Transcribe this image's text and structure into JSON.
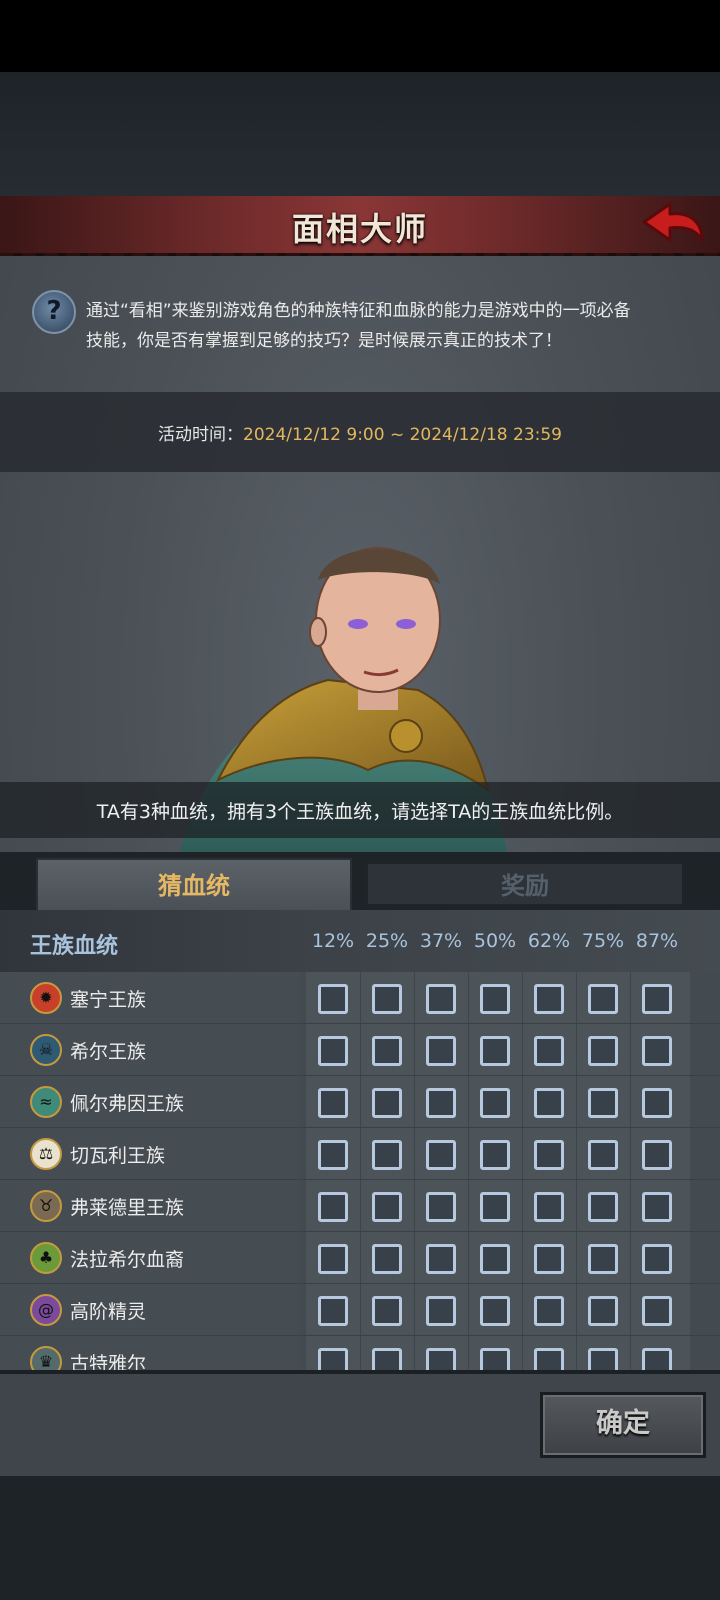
{
  "header": {
    "title": "面相大师"
  },
  "intro": {
    "text": "通过“看相”来鉴别游戏角色的种族特征和血脉的能力是游戏中的一项必备技能，你是否有掌握到足够的技巧？是时候展示真正的技术了！"
  },
  "event": {
    "label": "活动时间：",
    "value": "2024/12/12 9:00 ~ 2024/12/18 23:59"
  },
  "prompt": "TA有3种血统，拥有3个王族血统，请选择TA的王族血统比例。",
  "tabs": {
    "guess": "猜血统",
    "reward": "奖励"
  },
  "table": {
    "header": "王族血统",
    "percents": [
      "12%",
      "25%",
      "37%",
      "50%",
      "62%",
      "75%",
      "87%"
    ],
    "rows": [
      {
        "name": "塞宁王族",
        "emblem": "sun-emblem-icon",
        "color": "#c8402a"
      },
      {
        "name": "希尔王族",
        "emblem": "skull-emblem-icon",
        "color": "#2e5a74"
      },
      {
        "name": "佩尔弗因王族",
        "emblem": "wave-emblem-icon",
        "color": "#3f8a78"
      },
      {
        "name": "切瓦利王族",
        "emblem": "scales-emblem-icon",
        "color": "#e8e2cf"
      },
      {
        "name": "弗莱德里王族",
        "emblem": "demon-emblem-icon",
        "color": "#7a6a52"
      },
      {
        "name": "法拉希尔血裔",
        "emblem": "tree-emblem-icon",
        "color": "#6b9a3a"
      },
      {
        "name": "高阶精灵",
        "emblem": "spiral-emblem-icon",
        "color": "#7b4a9a"
      },
      {
        "name": "古特雅尔",
        "emblem": "crown-emblem-icon",
        "color": "#556a6a"
      }
    ]
  },
  "confirm": "确定",
  "colors": {
    "accent": "#e3b85c",
    "header_red": "#8a3636",
    "checkbox": "#b7c9de"
  }
}
